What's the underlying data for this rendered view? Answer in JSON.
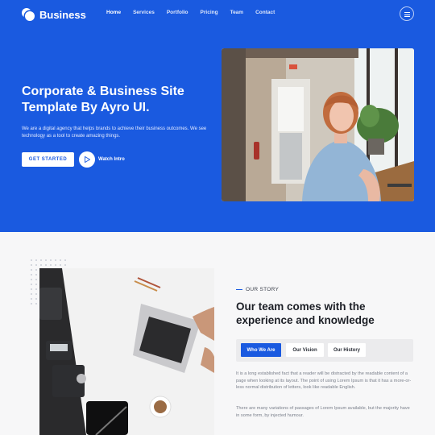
{
  "brand": {
    "name": "Business"
  },
  "nav": {
    "items": [
      "Home",
      "Services",
      "Portfolio",
      "Pricing",
      "Team",
      "Contact"
    ],
    "active": "Home"
  },
  "hero": {
    "title": "Corporate & Business Site Template By Ayro UI.",
    "description": "We are a digital agency that helps brands to achieve their business outcomes. We see technology as a tool to create amazing things.",
    "cta_label": "GET STARTED",
    "video_label": "Watch Intro"
  },
  "story": {
    "kicker": "OUR STORY",
    "title": "Our team comes with the experience and knowledge",
    "tabs": [
      "Who We Are",
      "Our Vision",
      "Our History"
    ],
    "active_tab": "Who We Are",
    "paragraphs": [
      "It is a long established fact that a reader will be distracted by the readable content of a page when looking at its layout. The point of using Lorem Ipsum is that it has a more-or-less normal distribution of letters, look like readable English.",
      "There are many variations of passages of Lorem Ipsum available, but the majority have in some form, by injected humour."
    ]
  },
  "colors": {
    "primary": "#1a5ae0",
    "section_bg": "#f7f7f8",
    "heading": "#1c1f26",
    "body_text": "#7b808c"
  },
  "icons": [
    "logo-icon",
    "menu-icon",
    "play-icon"
  ]
}
